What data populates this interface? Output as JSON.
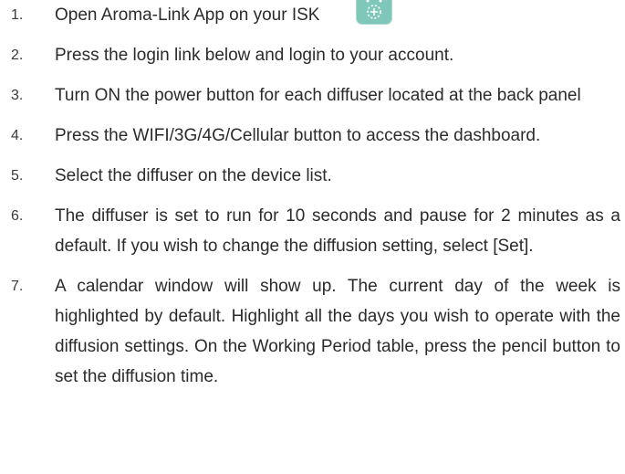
{
  "steps": [
    {
      "num": "1.",
      "text": "Open Aroma-Link App on your ISK",
      "icon": "aroma-link-app-icon"
    },
    {
      "num": "2.",
      "text": "Press the login link below and login to your account."
    },
    {
      "num": "3.",
      "text": "Turn ON the power button for each diffuser located at the back panel"
    },
    {
      "num": "4.",
      "text": "Press the WIFI/3G/4G/Cellular button to access the dashboard."
    },
    {
      "num": "5.",
      "text": "Select the diffuser on the device list."
    },
    {
      "num": "6.",
      "text": "The diffuser is set to run for 10 seconds and pause for 2 minutes as a default. If you wish to change the diffusion setting, select [Set]."
    },
    {
      "num": "7.",
      "text": "A calendar window will show up. The current day of the week is highlighted by default. Highlight all the days you wish to operate with the diffusion settings. On the Working Period table, press the pencil button to set the diffusion time."
    }
  ],
  "colors": {
    "text": "#2b2b2b",
    "icon_bg": "#7fc7b8"
  }
}
